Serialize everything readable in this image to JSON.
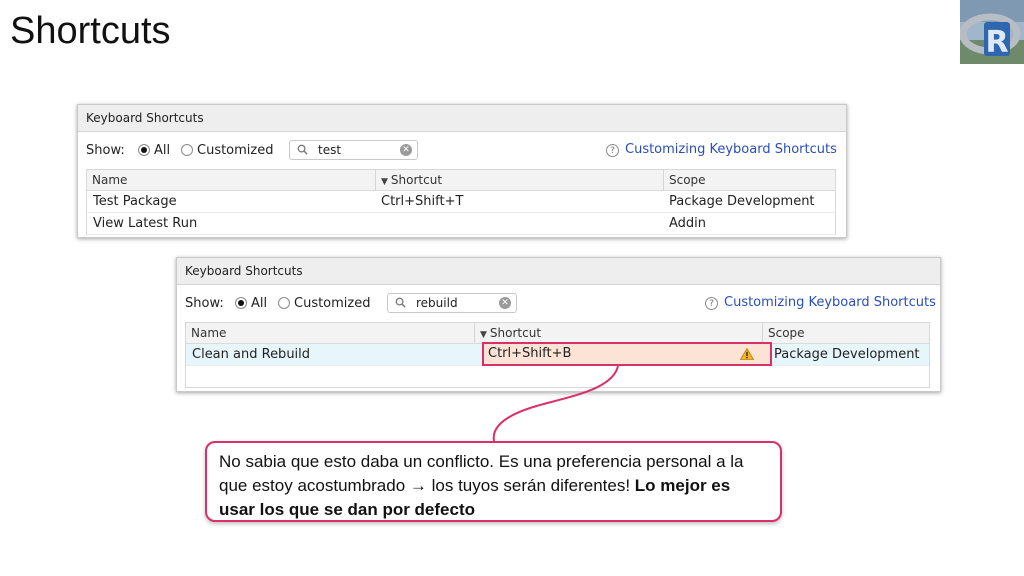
{
  "slide": {
    "title": "Shortcuts",
    "logo_icon": "r-logo-icon"
  },
  "panel_top": {
    "header": "Keyboard Shortcuts",
    "show_label": "Show:",
    "radio_all": "All",
    "radio_customized": "Customized",
    "selected_filter": "All",
    "search_value": "test",
    "help_link": "Customizing Keyboard Shortcuts",
    "columns": [
      "Name",
      "Shortcut",
      "Scope"
    ],
    "rows": [
      {
        "name": "Test Package",
        "shortcut": "Ctrl+Shift+T",
        "scope": "Package Development"
      },
      {
        "name": "View Latest Run",
        "shortcut": "",
        "scope": "Addin"
      }
    ]
  },
  "panel_bottom": {
    "header": "Keyboard Shortcuts",
    "show_label": "Show:",
    "radio_all": "All",
    "radio_customized": "Customized",
    "selected_filter": "All",
    "search_value": "rebuild",
    "help_link": "Customizing Keyboard Shortcuts",
    "columns": [
      "Name",
      "Shortcut",
      "Scope"
    ],
    "rows": [
      {
        "name": "Clean and Rebuild",
        "shortcut": "Ctrl+Shift+B",
        "scope": "Package Development",
        "conflict": true
      }
    ]
  },
  "callout": {
    "text_plain": "No sabia que esto daba un conflicto. Es una preferencia personal a la que estoy acostumbrado → los tuyos serán diferentes! ",
    "text_bold": "Lo mejor es usar los que se dan por defecto"
  },
  "colors": {
    "accent_pink": "#d9306a",
    "link_blue": "#2a4fb5",
    "conflict_bg": "#fbe3d6",
    "selected_row_bg": "#e6f6fb"
  }
}
